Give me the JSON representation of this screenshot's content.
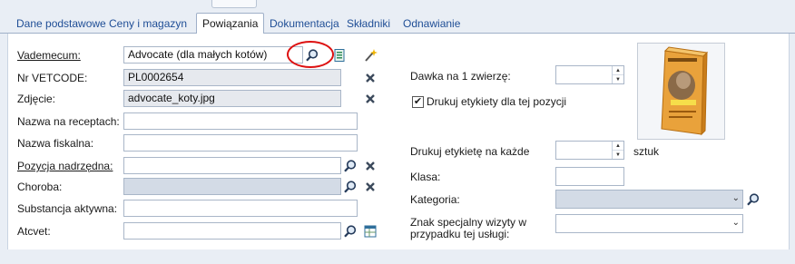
{
  "tabs": [
    {
      "label": "Dane podstawowe"
    },
    {
      "label": "Ceny i magazyn"
    },
    {
      "label": "Powiązania"
    },
    {
      "label": "Dokumentacja"
    },
    {
      "label": "Składniki"
    },
    {
      "label": "Odnawianie"
    }
  ],
  "active_tab": "Powiązania",
  "form": {
    "vademecum": {
      "label": "Vademecum:",
      "value": "Advocate (dla małych kotów)"
    },
    "vetcode": {
      "label": "Nr VETCODE:",
      "value": "PL0002654"
    },
    "photo": {
      "label": "Zdjęcie:",
      "value": "advocate_koty.jpg"
    },
    "prescription_name": {
      "label": "Nazwa na receptach:",
      "value": ""
    },
    "fiscal_name": {
      "label": "Nazwa fiskalna:",
      "value": ""
    },
    "parent_item": {
      "label": "Pozycja nadrzędna:",
      "value": ""
    },
    "disease": {
      "label": "Choroba:",
      "value": ""
    },
    "active_substance": {
      "label": "Substancja aktywna:",
      "value": ""
    },
    "atcvet": {
      "label": "Atcvet:",
      "value": ""
    }
  },
  "right": {
    "dose_label": "Dawka na 1 zwierzę:",
    "print_labels_label": "Drukuj etykiety dla tej pozycji",
    "print_labels_checked": true,
    "print_every_label": "Drukuj etykietę na każde",
    "print_every_unit": "sztuk",
    "class_label": "Klasa:",
    "category_label": "Kategoria:",
    "special_mark_label_line1": "Znak specjalny wizyty w",
    "special_mark_label_line2": "przypadku tej usługi:"
  },
  "icons": {
    "search": "magnifier-icon",
    "clear": "x-icon",
    "wand": "magic-wand-icon",
    "doc": "document-icon",
    "table": "table-icon"
  },
  "colors": {
    "accent_tab_text": "#1f4e96",
    "highlight_circle": "#dd1111",
    "disabled_field": "#d3dbe6"
  }
}
